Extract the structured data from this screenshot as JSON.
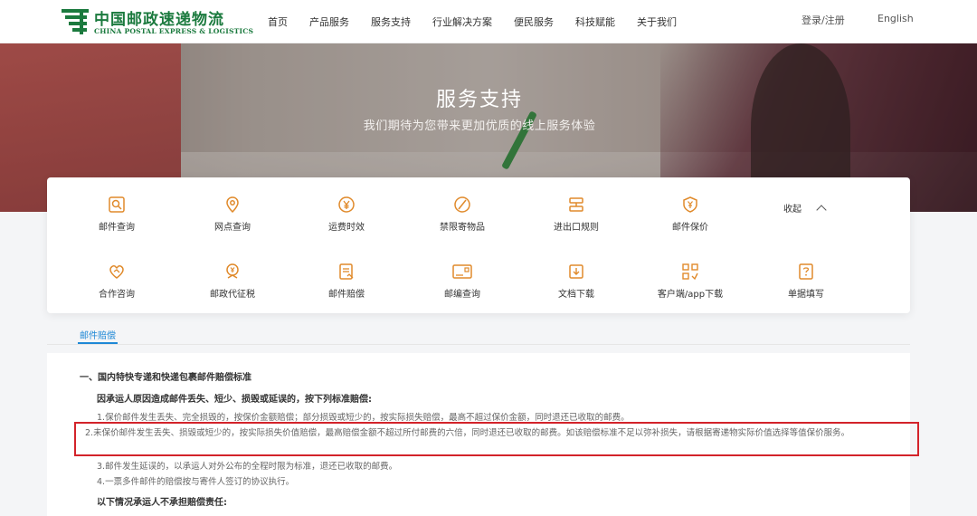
{
  "header": {
    "logo_cn": "中国邮政速递物流",
    "logo_en": "CHINA POSTAL EXPRESS & LOGISTICS",
    "nav": [
      "首页",
      "产品服务",
      "服务支持",
      "行业解决方案",
      "便民服务",
      "科技赋能",
      "关于我们"
    ],
    "login": "登录/注册",
    "language": "English",
    "brand_color": "#1b7a3e"
  },
  "hero": {
    "title": "服务支持",
    "subtitle": "我们期待为您带来更加优质的线上服务体验"
  },
  "services": {
    "row1": [
      {
        "label": "邮件查询",
        "icon": "mail-search-icon"
      },
      {
        "label": "网点查询",
        "icon": "location-pin-icon"
      },
      {
        "label": "运费时效",
        "icon": "yen-circle-icon"
      },
      {
        "label": "禁限寄物品",
        "icon": "prohibited-icon"
      },
      {
        "label": "进出口规则",
        "icon": "rules-icon"
      },
      {
        "label": "邮件保价",
        "icon": "shield-yen-icon"
      }
    ],
    "row2": [
      {
        "label": "合作咨询",
        "icon": "handshake-icon"
      },
      {
        "label": "邮政代征税",
        "icon": "tax-icon"
      },
      {
        "label": "邮件赔偿",
        "icon": "claim-document-icon"
      },
      {
        "label": "邮编查询",
        "icon": "postcode-icon"
      },
      {
        "label": "文档下载",
        "icon": "download-icon"
      },
      {
        "label": "客户端/app下载",
        "icon": "app-grid-icon"
      },
      {
        "label": "单据填写",
        "icon": "form-question-icon"
      }
    ],
    "collapse_label": "收起",
    "icon_color": "#e08a2b"
  },
  "tab": {
    "label": "邮件赔偿",
    "accent": "#1e88d6"
  },
  "content": {
    "section_title": "一、国内特快专递和快递包裹邮件赔偿标准",
    "sub_heading": "因承运人原因造成邮件丢失、短少、损毁或延误的，按下列标准赔偿:",
    "p1": "1.保价邮件发生丢失、完全损毁的，按保价金额赔偿；部分损毁或短少的，按实际损失赔偿，最高不超过保价金额，同时退还已收取的邮费。",
    "p2": "2.未保价邮件发生丢失、损毁或短少的，按实际损失价值赔偿，最高赔偿金额不超过所付邮费的六倍，同时退还已收取的邮费。如该赔偿标准不足以弥补损失，请根据寄递物实际价值选择等值保价服务。",
    "p3": "3.邮件发生延误的，以承运人对外公布的全程时限为标准，退还已收取的邮费。",
    "p4": "4.一票多件邮件的赔偿按与寄件人签订的协议执行。",
    "sub_heading2": "以下情况承运人不承担赔偿责任:",
    "highlight_color": "#d3232a"
  }
}
